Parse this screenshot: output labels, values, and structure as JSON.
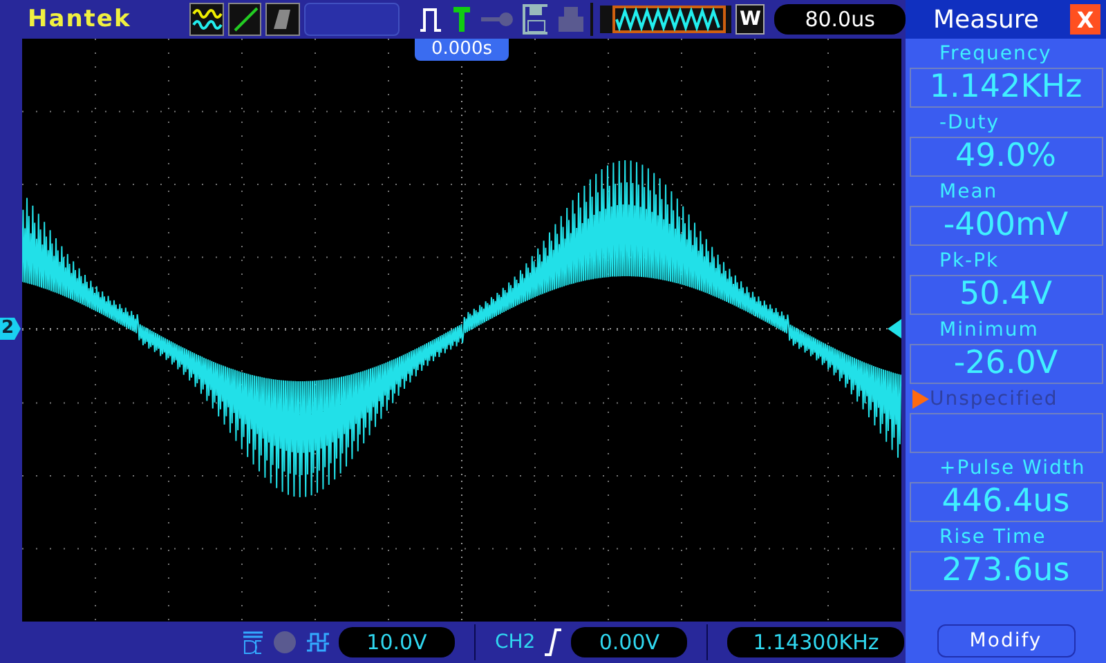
{
  "top_bar": {
    "logo": "Hantek",
    "timebase": "80.0us",
    "window_button": "W",
    "trigger_position": "0.000s"
  },
  "screen": {
    "channel_marker": "2"
  },
  "measure_panel": {
    "title": "Measure",
    "close": "X",
    "items": [
      {
        "label": "Frequency",
        "value": "1.142KHz",
        "selected": false
      },
      {
        "label": "-Duty",
        "value": "49.0%",
        "selected": false
      },
      {
        "label": "Mean",
        "value": "-400mV",
        "selected": false
      },
      {
        "label": "Pk-Pk",
        "value": "50.4V",
        "selected": false
      },
      {
        "label": "Minimum",
        "value": "-26.0V",
        "selected": false
      },
      {
        "label": "Unspecified",
        "selected": true
      },
      {
        "label": "+Pulse Width",
        "value": "446.4us",
        "selected": false
      },
      {
        "label": "Rise Time",
        "value": "273.6us",
        "selected": false
      }
    ],
    "button": "Modify"
  },
  "status_bar": {
    "volts_per_div": "10.0V",
    "trigger_channel": "CH2",
    "trigger_level": "0.00V",
    "frequency": "1.14300KHz"
  }
}
